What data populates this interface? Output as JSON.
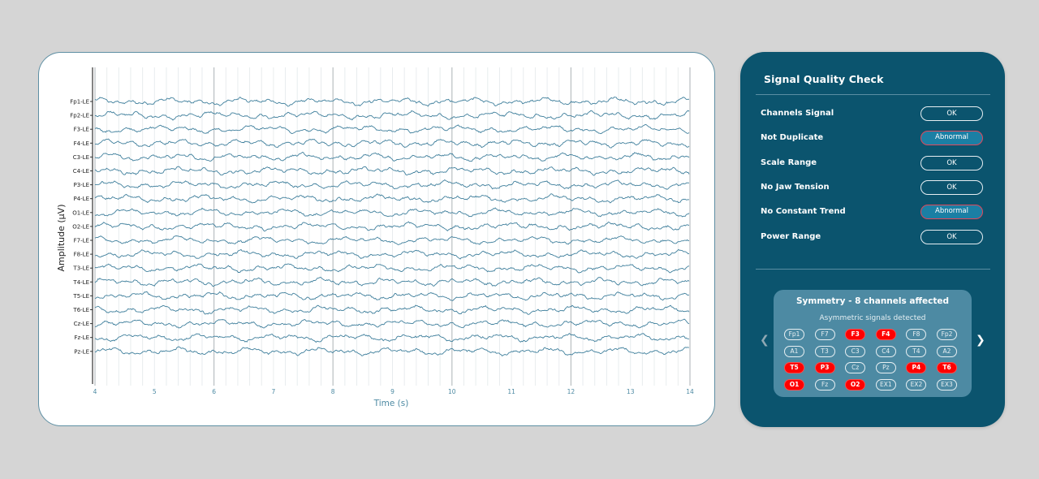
{
  "chart_data": {
    "type": "line",
    "title": "",
    "xlabel": "Time (s)",
    "ylabel": "Amplitude (µV)",
    "xlim": [
      4,
      14
    ],
    "x_ticks": [
      "4",
      "5",
      "6",
      "7",
      "8",
      "9",
      "10",
      "11",
      "12",
      "13",
      "14"
    ],
    "minor_grid_step_s": 0.2,
    "major_grid_step_s": 2,
    "grid": true,
    "line_color": "#3f7f9c",
    "channels": [
      "Fp1-LE",
      "Fp2-LE",
      "F3-LE",
      "F4-LE",
      "C3-LE",
      "C4-LE",
      "P3-LE",
      "P4-LE",
      "O1-LE",
      "O2-LE",
      "F7-LE",
      "F8-LE",
      "T3-LE",
      "T4-LE",
      "T5-LE",
      "T6-LE",
      "Cz-LE",
      "Fz-LE",
      "Pz-LE"
    ],
    "series_note": "19 stacked EEG traces, each a noisy oscillation around its channel baseline"
  },
  "panel": {
    "title": "Signal Quality Check",
    "checks": [
      {
        "label": "Channels Signal",
        "status": "OK",
        "abnormal": false
      },
      {
        "label": "Not Duplicate",
        "status": "Abnormal",
        "abnormal": true
      },
      {
        "label": "Scale Range",
        "status": "OK",
        "abnormal": false
      },
      {
        "label": "No Jaw Tension",
        "status": "OK",
        "abnormal": false
      },
      {
        "label": "No Constant Trend",
        "status": "Abnormal",
        "abnormal": true
      },
      {
        "label": "Power Range",
        "status": "OK",
        "abnormal": false
      }
    ],
    "symmetry": {
      "title": "Symmetry - 8 channels affected",
      "subtitle": "Asymmetric signals detected",
      "prev_icon": "chevron-left-icon",
      "next_icon": "chevron-right-icon",
      "chips": [
        [
          {
            "label": "Fp1",
            "affected": false
          },
          {
            "label": "F7",
            "affected": false
          },
          {
            "label": "F3",
            "affected": true
          },
          {
            "label": "F4",
            "affected": true
          },
          {
            "label": "F8",
            "affected": false
          },
          {
            "label": "Fp2",
            "affected": false
          }
        ],
        [
          {
            "label": "A1",
            "affected": false
          },
          {
            "label": "T3",
            "affected": false
          },
          {
            "label": "C3",
            "affected": false
          },
          {
            "label": "C4",
            "affected": false
          },
          {
            "label": "T4",
            "affected": false
          },
          {
            "label": "A2",
            "affected": false
          }
        ],
        [
          {
            "label": "T5",
            "affected": true
          },
          {
            "label": "P3",
            "affected": true
          },
          {
            "label": "Cz",
            "affected": false
          },
          {
            "label": "Pz",
            "affected": false
          },
          {
            "label": "P4",
            "affected": true
          },
          {
            "label": "T6",
            "affected": true
          }
        ],
        [
          {
            "label": "O1",
            "affected": true
          },
          {
            "label": "Fz",
            "affected": false
          },
          {
            "label": "O2",
            "affected": true
          },
          {
            "label": "EX1",
            "affected": false
          },
          {
            "label": "EX2",
            "affected": false
          },
          {
            "label": "EX3",
            "affected": false
          }
        ]
      ]
    },
    "colors": {
      "panel_bg": "#0b546e",
      "abnormal_border": "#e2485b",
      "affected_chip": "#ff0000"
    }
  }
}
